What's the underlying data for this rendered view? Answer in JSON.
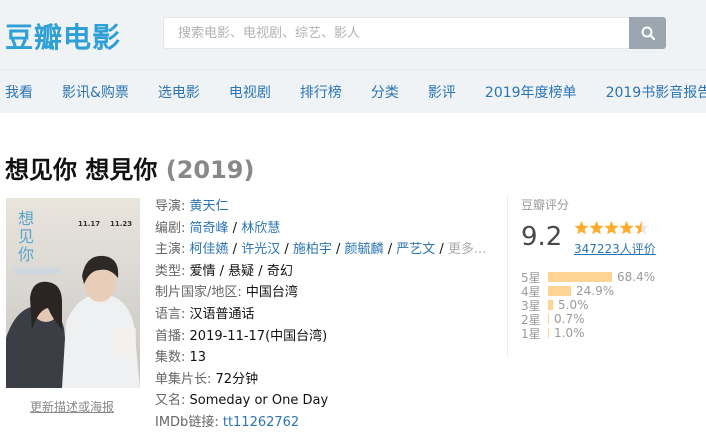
{
  "header": {
    "logo": "豆瓣电影",
    "search_placeholder": "搜索电影、电视剧、综艺、影人"
  },
  "nav": [
    "我看",
    "影讯&购票",
    "选电影",
    "电视剧",
    "排行榜",
    "分类",
    "影评",
    "2019年度榜单",
    "2019书影音报告"
  ],
  "title": {
    "name": "想见你 想見你",
    "year": "(2019)"
  },
  "poster": {
    "link": "更新描述或海报",
    "text_main": "想见你",
    "date1": "11.17",
    "date2": "11.23"
  },
  "info": {
    "director_label": "导演:",
    "director": "黄天仁",
    "writer_label": "编剧:",
    "writers": [
      "简奇峰",
      "林欣慧"
    ],
    "cast_label": "主演:",
    "cast": [
      "柯佳嬿",
      "许光汉",
      "施柏宇",
      "颜毓麟",
      "严艺文"
    ],
    "more": "更多...",
    "genre_label": "类型:",
    "genre": "爱情 / 悬疑 / 奇幻",
    "country_label": "制片国家/地区:",
    "country": "中国台湾",
    "language_label": "语言:",
    "language": "汉语普通话",
    "premiere_label": "首播:",
    "premiere": "2019-11-17(中国台湾)",
    "episodes_label": "集数:",
    "episodes": "13",
    "runtime_label": "单集片长:",
    "runtime": "72分钟",
    "aka_label": "又名:",
    "aka": "Someday or One Day",
    "imdb_label": "IMDb链接:",
    "imdb": "tt11262762"
  },
  "rating": {
    "label": "豆瓣评分",
    "score": "9.2",
    "stars": 4.5,
    "count": "347223人评价",
    "dist": [
      {
        "label": "5星",
        "pct": "68.4%",
        "value": 68.4
      },
      {
        "label": "4星",
        "pct": "24.9%",
        "value": 24.9
      },
      {
        "label": "3星",
        "pct": "5.0%",
        "value": 5.0
      },
      {
        "label": "2星",
        "pct": "0.7%",
        "value": 0.7
      },
      {
        "label": "1星",
        "pct": "1.0%",
        "value": 1.0
      }
    ]
  }
}
